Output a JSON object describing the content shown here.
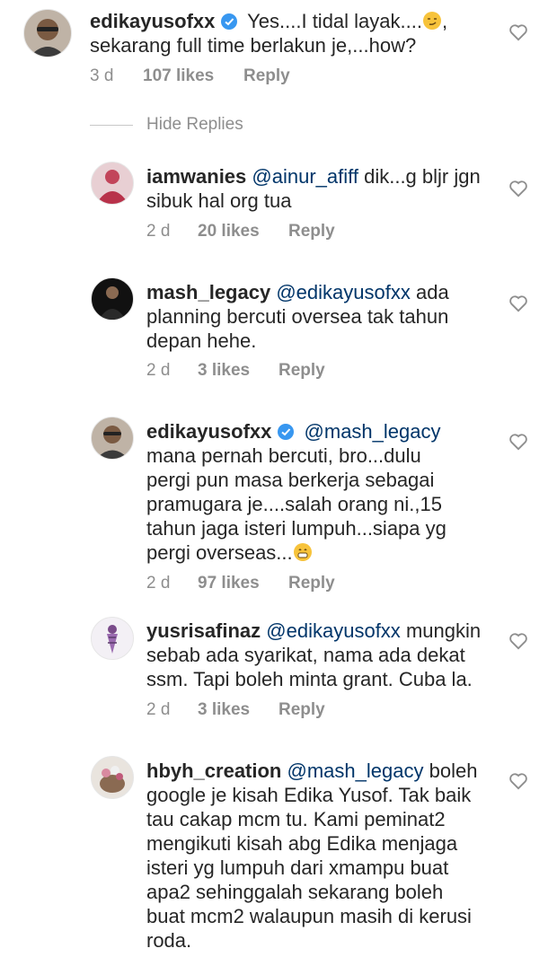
{
  "comments": [
    {
      "username": "edikayusofxx",
      "verified": true,
      "mention": "",
      "lines": [
        "Yes....I tidal layak....",
        "sekarang full time berlakun je,...how?"
      ],
      "line1_suffix": ",",
      "time": "3 d",
      "likes": "107 likes",
      "reply": "Reply"
    },
    {
      "username": "iamwanies",
      "verified": false,
      "mention": "@ainur_afiff",
      "lines": [
        "dik...g bljr jgn",
        "sibuk hal org tua"
      ],
      "time": "2 d",
      "likes": "20 likes",
      "reply": "Reply"
    },
    {
      "username": "mash_legacy",
      "verified": false,
      "mention": "@edikayusofxx",
      "lines": [
        "ada",
        "planning bercuti oversea tak tahun",
        "depan hehe."
      ],
      "time": "2 d",
      "likes": "3 likes",
      "reply": "Reply"
    },
    {
      "username": "edikayusofxx",
      "verified": true,
      "mention": "@mash_legacy",
      "lines": [
        "",
        "mana pernah bercuti, bro...dulu",
        "pergi pun masa berkerja sebagai",
        "pramugara je....salah orang ni.,15",
        "tahun jaga isteri lumpuh...siapa yg",
        "pergi overseas..."
      ],
      "time": "2 d",
      "likes": "97 likes",
      "reply": "Reply"
    },
    {
      "username": "yusrisafinaz",
      "verified": false,
      "mention": "@edikayusofxx",
      "lines": [
        "mungkin",
        "sebab ada syarikat, nama ada dekat",
        "ssm. Tapi boleh minta grant. Cuba la."
      ],
      "time": "2 d",
      "likes": "3 likes",
      "reply": "Reply"
    },
    {
      "username": "hbyh_creation",
      "verified": false,
      "mention": "@mash_legacy",
      "lines": [
        "boleh",
        "google je kisah Edika Yusof. Tak baik",
        "tau cakap mcm tu. Kami peminat2",
        "mengikuti kisah abg Edika menjaga",
        "isteri yg lumpuh dari xmampu buat",
        "apa2 sehinggalah sekarang boleh",
        "buat mcm2 walaupun masih di kerusi",
        "roda."
      ],
      "time": "",
      "likes": "",
      "reply": ""
    }
  ],
  "hide_replies": "Hide Replies",
  "icons": {
    "heart": "heart-outline-icon",
    "verified": "verified-badge-icon",
    "emoji_smirk": "smirking-face-emoji",
    "emoji_grin": "grimacing-face-emoji"
  },
  "colors": {
    "text": "#262626",
    "secondary": "#8e8e8e",
    "mention": "#003569",
    "verified": "#3897f0"
  }
}
